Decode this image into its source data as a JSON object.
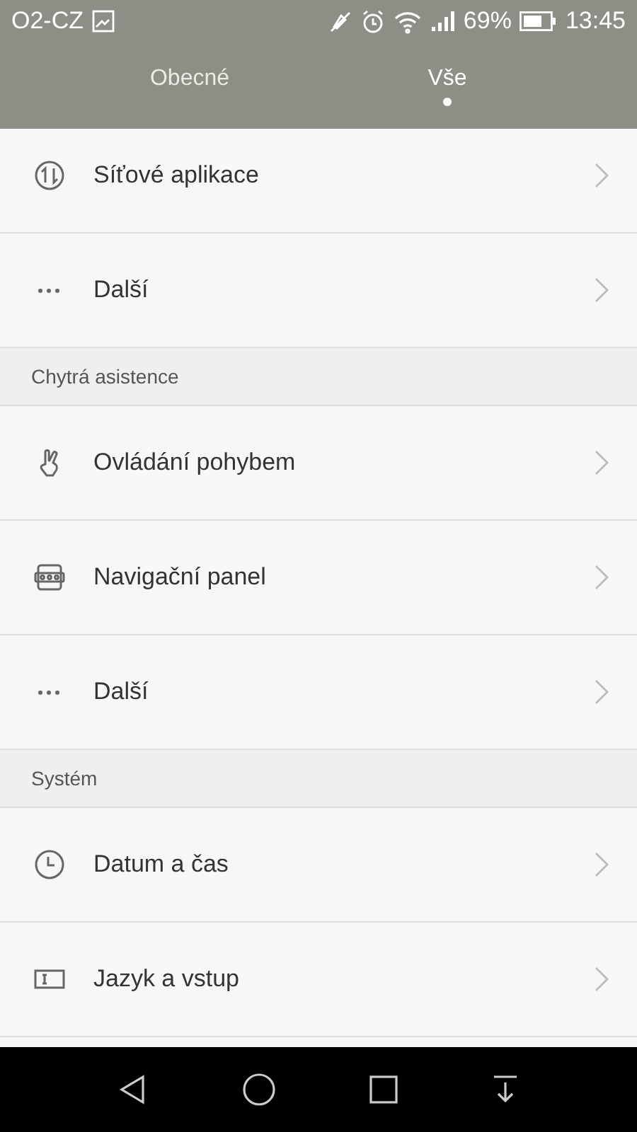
{
  "status_bar": {
    "carrier": "O2-CZ",
    "battery": "69%",
    "time": "13:45"
  },
  "tabs": [
    {
      "label": "Obecné",
      "selected": false
    },
    {
      "label": "Vše",
      "selected": true
    }
  ],
  "sections": [
    {
      "items": [
        {
          "kind": "network",
          "label": "Síťové aplikace"
        },
        {
          "kind": "more",
          "label": "Další"
        }
      ]
    },
    {
      "title": "Chytrá asistence",
      "items": [
        {
          "kind": "gesture",
          "label": "Ovládání pohybem"
        },
        {
          "kind": "navbar",
          "label": "Navigační panel"
        },
        {
          "kind": "more",
          "label": "Další"
        }
      ]
    },
    {
      "title": "Systém",
      "items": [
        {
          "kind": "clock",
          "label": "Datum a čas"
        },
        {
          "kind": "input",
          "label": "Jazyk a vstup"
        }
      ]
    }
  ]
}
